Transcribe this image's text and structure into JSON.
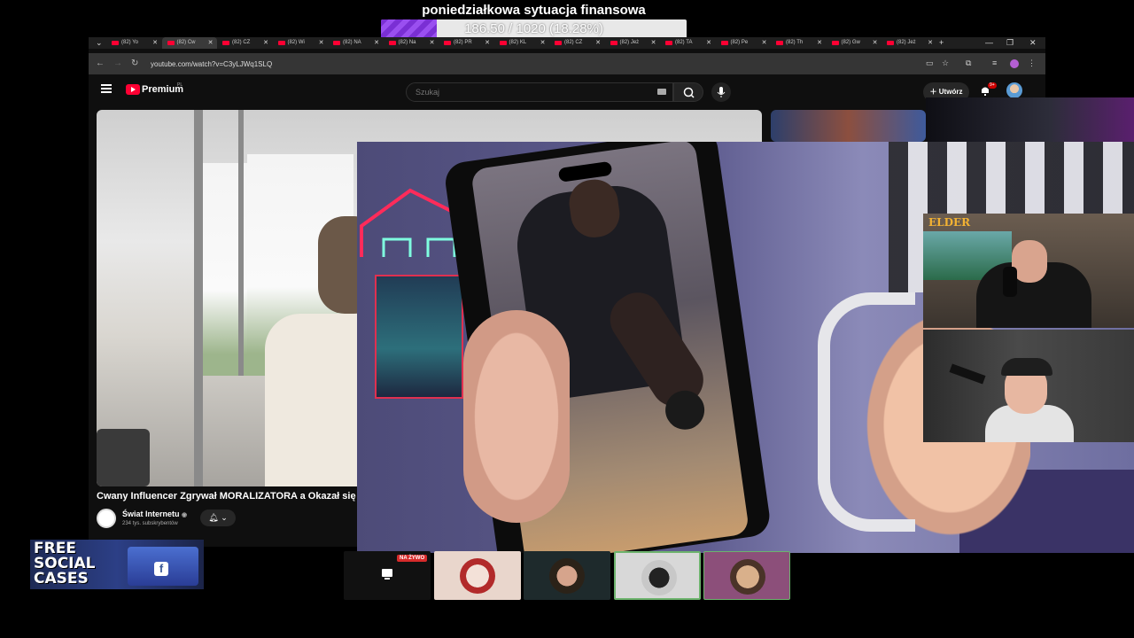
{
  "overlay": {
    "goal_title": "poniedziałkowa sytuacja finansowa",
    "goal_text": "186.50 / 1020 (18.28%)",
    "goal_progress": 0.1828,
    "goal_color": "#7a2fd4"
  },
  "browser": {
    "tabs": [
      {
        "label": "(82) Yo"
      },
      {
        "label": "(82) Cw",
        "active": true
      },
      {
        "label": "(82) CZ"
      },
      {
        "label": "(82) Wi"
      },
      {
        "label": "(82) NA"
      },
      {
        "label": "(82) Na"
      },
      {
        "label": "(82) PR"
      },
      {
        "label": "(82) KL"
      },
      {
        "label": "(82) CZ"
      },
      {
        "label": "(82) Jeż"
      },
      {
        "label": "(82) TA"
      },
      {
        "label": "(82) Pe"
      },
      {
        "label": "(82) Th"
      },
      {
        "label": "(82) Gw"
      },
      {
        "label": "(82) Jeż"
      }
    ],
    "new_tab": "+",
    "url": "youtube.com/watch?v=C3yLJWq1SLQ",
    "win_controls": [
      "—",
      "❐",
      "✕"
    ]
  },
  "youtube": {
    "brand": "Premium",
    "country": "PL",
    "search_placeholder": "Szukaj",
    "create_label": "Utwórz",
    "notif_count": "9+",
    "video_title": "Cwany Influencer Zgrywał MORALIZATORA a Okazał się ...",
    "channel_name": "Świat Internetu",
    "channel_subs": "234 tys. subskrybentów",
    "accent": "#ff0033"
  },
  "cams": {
    "elder_logo": "ELDER"
  },
  "ad": {
    "line1": "FREE",
    "line2": "SOCIAL",
    "line3": "CASES",
    "fb": "f"
  },
  "caller_bar": {
    "live_label": "NA ŻYWO"
  }
}
